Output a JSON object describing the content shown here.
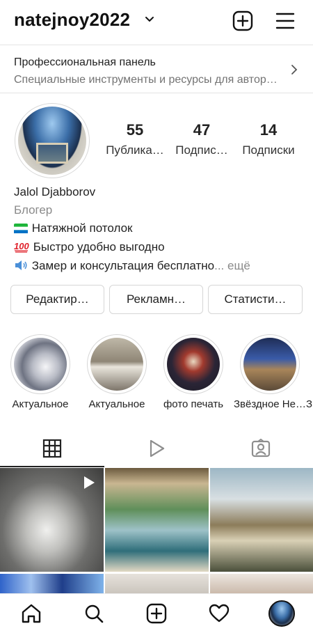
{
  "header": {
    "username": "natejnoy2022",
    "chevron_icon": "chevron-down-icon",
    "new_post_icon": "plus-square-icon",
    "menu_icon": "hamburger-menu-icon"
  },
  "professional_panel": {
    "title": "Профессиональная панель",
    "subtitle": "Специальные инструменты и ресурсы для автор…"
  },
  "profile": {
    "stats": [
      {
        "value": "55",
        "label": "Публика…"
      },
      {
        "value": "47",
        "label": "Подпис…"
      },
      {
        "value": "14",
        "label": "Подписки"
      }
    ],
    "name": "Jalol Djabborov",
    "category": "Блогер",
    "bio_lines": [
      "Натяжной потолок",
      "Быстро удобно выгодно",
      "Замер и консультация бесплатно"
    ],
    "bio_more": "... ещё"
  },
  "buttons": {
    "edit": "Редактир…",
    "ads": "Рекламн…",
    "stats": "Статисти…"
  },
  "highlights": [
    {
      "label": "Актуальное"
    },
    {
      "label": "Актуальное"
    },
    {
      "label": "фото печать"
    },
    {
      "label": "Звёздное Не…"
    }
  ],
  "tabs": [
    {
      "icon": "grid-icon"
    },
    {
      "icon": "reels-icon"
    },
    {
      "icon": "tagged-icon"
    }
  ],
  "bottom_nav": [
    {
      "icon": "home-icon"
    },
    {
      "icon": "search-icon"
    },
    {
      "icon": "new-post-icon"
    },
    {
      "icon": "heart-icon"
    },
    {
      "icon": "profile-avatar"
    }
  ]
}
